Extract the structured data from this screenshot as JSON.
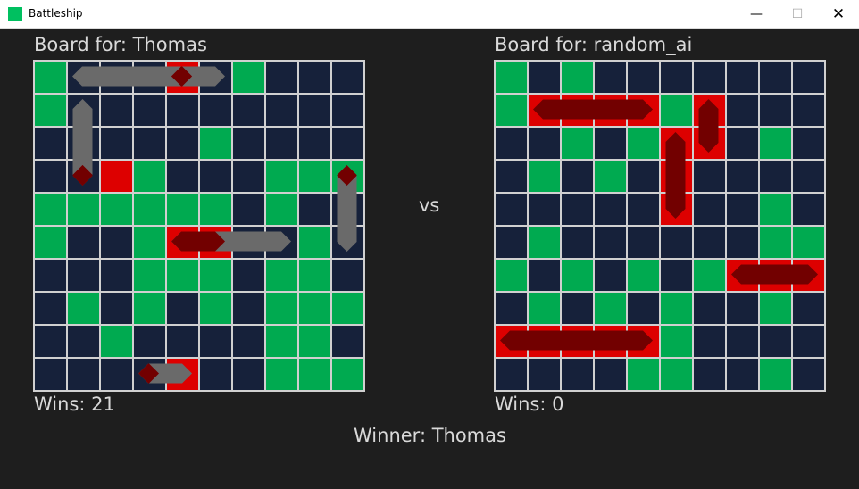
{
  "window": {
    "title": "Battleship"
  },
  "colors": {
    "water": "#16213a",
    "miss": "#00aa50",
    "hit": "#dd0000",
    "ship": "#6a6a6a",
    "sunk_ship": "#720000",
    "grid": "#d0d0d0"
  },
  "left": {
    "title": "Board for: Thomas",
    "wins": "Wins: 21",
    "grid": [
      "G...R.G...",
      "G.........",
      ".....G....",
      "..RG...GGGR",
      "GGGGGG.G..",
      "G..GRR..G.",
      "...GGG.GG.",
      ".G.G.G.GGG",
      "..G....GG.",
      "....R..GGG.."
    ],
    "ships": [
      {
        "x": 1,
        "y": 0,
        "dir": "h",
        "len": 5,
        "sunk": false
      },
      {
        "x": 1,
        "y": 1,
        "dir": "v",
        "len": 3,
        "sunk": false
      },
      {
        "x": 1,
        "y": 3,
        "dir": "v",
        "len": 1,
        "sunk": true
      },
      {
        "x": 4,
        "y": 0,
        "dir": "h",
        "len": 1,
        "sunk": true
      },
      {
        "x": 9,
        "y": 3,
        "dir": "v",
        "len": 3,
        "sunk": false
      },
      {
        "x": 4,
        "y": 5,
        "dir": "h",
        "len": 4,
        "sunk": false
      },
      {
        "x": 3,
        "y": 9,
        "dir": "h",
        "len": 2,
        "sunk": false
      }
    ],
    "sunk_segments": [
      {
        "x": 1,
        "y": 3,
        "dir": "v",
        "len": 1
      },
      {
        "x": 4,
        "y": 0,
        "dir": "h",
        "len": 1
      },
      {
        "x": 9,
        "y": 3,
        "dir": "v",
        "len": 1
      },
      {
        "x": 4,
        "y": 5,
        "dir": "h",
        "len": 2
      },
      {
        "x": 3,
        "y": 9,
        "dir": "h",
        "len": 1
      }
    ]
  },
  "vs_label": "vs",
  "right": {
    "title": "Board for: random_ai",
    "wins": "Wins: 0",
    "grid": [
      "G.G.......",
      "GRRRRGR...",
      "..G.GRR.G.",
      ".G.G.R....",
      ".....R..G.",
      ".G......GG",
      "G.G.G.GRRR",
      ".G.G.G..G.G",
      "RRRRRG....",
      "....GG..G.G"
    ],
    "ships": [
      {
        "x": 1,
        "y": 1,
        "dir": "h",
        "len": 4,
        "sunk": true
      },
      {
        "x": 6,
        "y": 1,
        "dir": "v",
        "len": 2,
        "sunk": true
      },
      {
        "x": 5,
        "y": 2,
        "dir": "v",
        "len": 3,
        "sunk": true
      },
      {
        "x": 7,
        "y": 6,
        "dir": "h",
        "len": 3,
        "sunk": true
      },
      {
        "x": 0,
        "y": 8,
        "dir": "h",
        "len": 5,
        "sunk": true
      }
    ]
  },
  "winner": "Winner: Thomas"
}
